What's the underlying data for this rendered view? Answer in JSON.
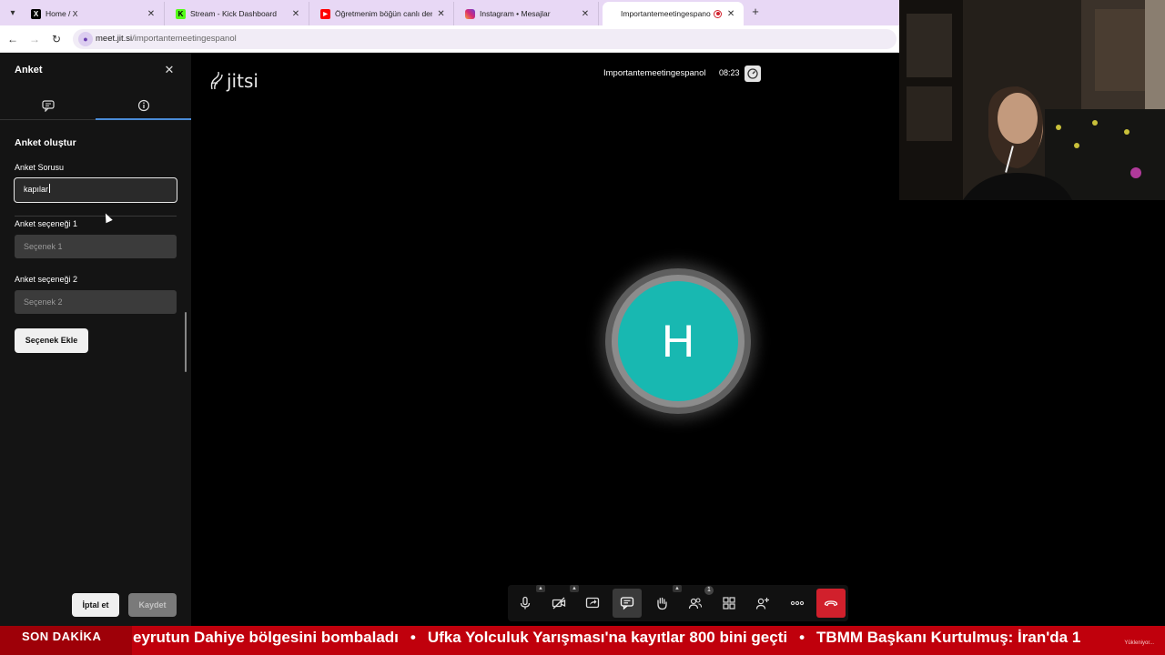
{
  "browser": {
    "tabs": [
      {
        "title": "Home / X",
        "favicon": "x-logo"
      },
      {
        "title": "Stream - Kick Dashboard",
        "favicon": "kick-logo"
      },
      {
        "title": "Öğretmenim böğün canlı ders v",
        "favicon": "youtube-logo"
      },
      {
        "title": "Instagram • Mesajlar",
        "favicon": "instagram-logo"
      },
      {
        "title": "Importantemeetingespanol",
        "favicon": "recording-icon",
        "active": true
      }
    ],
    "url_host": "meet.jit.si",
    "url_path": "/importantemeetingespanol"
  },
  "sidebar": {
    "title": "Anket",
    "tabs": [
      "chat-icon",
      "poll-info-icon"
    ],
    "heading": "Anket oluştur",
    "question_label": "Anket Sorusu",
    "question_value": "kapılar",
    "option1_label": "Anket seçeneği 1",
    "option1_placeholder": "Seçenek 1",
    "option2_label": "Anket seçeneği 2",
    "option2_placeholder": "Seçenek 2",
    "add_option": "Seçenek Ekle",
    "cancel": "İptal et",
    "save": "Kaydet"
  },
  "meeting": {
    "logo": "jitsi",
    "name": "Importantemeetingespanol",
    "time": "08:23",
    "avatar_initial": "H",
    "avatar_color": "#18b8b1"
  },
  "toolbar": {
    "participants_count": "1",
    "hangup_color": "#d1202c"
  },
  "ticker": {
    "badge": "SON DAKİKA",
    "items": [
      "eyrutun Dahiye bölgesini bombaladı",
      "Ufka Yolculuk Yarışması'na kayıtlar 800 bini geçti",
      "TBMM Başkanı Kurtulmuş: İran'da 1"
    ],
    "separator": "•",
    "loading": "Yükleniyor..."
  }
}
